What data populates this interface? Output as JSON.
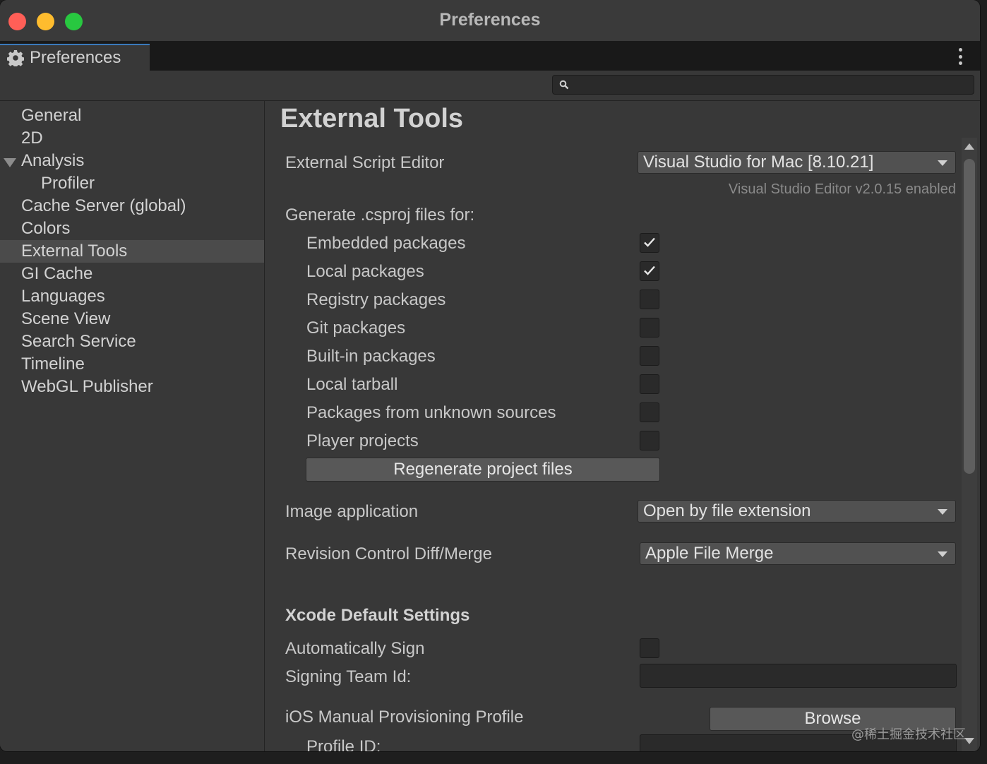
{
  "window": {
    "title": "Preferences"
  },
  "tab": {
    "label": "Preferences"
  },
  "search": {
    "placeholder": "",
    "value": ""
  },
  "sidebar": {
    "items": [
      {
        "label": "General"
      },
      {
        "label": "2D"
      },
      {
        "label": "Analysis"
      },
      {
        "label": "Profiler"
      },
      {
        "label": "Cache Server (global)"
      },
      {
        "label": "Colors"
      },
      {
        "label": "External Tools",
        "selected": true
      },
      {
        "label": "GI Cache"
      },
      {
        "label": "Languages"
      },
      {
        "label": "Scene View"
      },
      {
        "label": "Search Service"
      },
      {
        "label": "Timeline"
      },
      {
        "label": "WebGL Publisher"
      }
    ]
  },
  "main": {
    "title": "External Tools",
    "script_editor": {
      "label": "External Script Editor",
      "value": "Visual Studio for Mac [8.10.21]",
      "hint": "Visual Studio Editor v2.0.15 enabled"
    },
    "csproj": {
      "heading": "Generate .csproj files for:",
      "options": [
        {
          "label": "Embedded packages",
          "checked": true
        },
        {
          "label": "Local packages",
          "checked": true
        },
        {
          "label": "Registry packages",
          "checked": false
        },
        {
          "label": "Git packages",
          "checked": false
        },
        {
          "label": "Built-in packages",
          "checked": false
        },
        {
          "label": "Local tarball",
          "checked": false
        },
        {
          "label": "Packages from unknown sources",
          "checked": false
        },
        {
          "label": "Player projects",
          "checked": false
        }
      ],
      "regenerate_label": "Regenerate project files"
    },
    "image_app": {
      "label": "Image application",
      "value": "Open by file extension"
    },
    "diff_merge": {
      "label": "Revision Control Diff/Merge",
      "value": "Apple File Merge"
    },
    "xcode": {
      "heading": "Xcode Default Settings",
      "auto_sign_label": "Automatically Sign",
      "auto_sign_checked": false,
      "signing_team_label": "Signing Team Id:",
      "signing_team_value": "",
      "ios_profile_label": "iOS Manual Provisioning Profile",
      "browse_label": "Browse",
      "profile_id_label": "Profile ID:"
    }
  },
  "watermark": "@稀土掘金技术社区",
  "colors": {
    "window_bg": "#383838",
    "selected_bg": "#4b4b4b",
    "accent_tab": "#3a79bb",
    "close": "#ff5f57",
    "minimize": "#febc2e",
    "maximize": "#28c840"
  }
}
